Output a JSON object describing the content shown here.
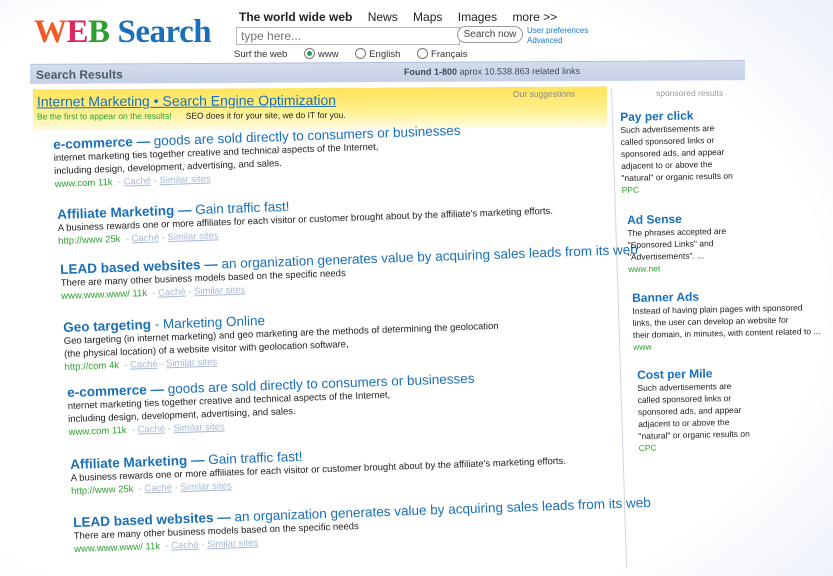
{
  "logo": {
    "w": "W",
    "e": "E",
    "b": "B",
    "search": "Search"
  },
  "nav": {
    "items": [
      "The world wide web",
      "News",
      "Maps",
      "Images",
      "more >>"
    ],
    "active": 0
  },
  "search": {
    "placeholder": "type here...",
    "button": "Search now"
  },
  "links": {
    "preferences": "User preferences",
    "advanced": "Advanced"
  },
  "surf": {
    "label": "Surf the web",
    "options": [
      "www",
      "English",
      "Français"
    ],
    "selected": 0
  },
  "results_bar": {
    "title": "Search Results",
    "found_bold": "Found 1-800",
    "found_rest": " aprox 10.538.863 related links"
  },
  "suggestion": {
    "label": "Our suggestions",
    "title": "Internet Marketing • Search Engine Optimization",
    "tagline": "Be the first to appear on the results!",
    "text": "SEO does it for your site, we do IT for you."
  },
  "results": [
    {
      "bold": "e-commerce —",
      "rest": " goods are sold directly to consumers or businesses",
      "desc": [
        "internet marketing ties together creative and technical aspects of the Internet,",
        "including design, development, advertising, and sales."
      ],
      "url": "www.com  11k",
      "cache": "Caché",
      "similar": "Similar sites"
    },
    {
      "bold": "Affiliate Marketing —",
      "rest": " Gain traffic fast!",
      "desc": [
        "A business rewards one or more affiliates for each visitor or customer brought about by the affiliate's marketing efforts."
      ],
      "url": "http://www  25k",
      "cache": "Caché",
      "similar": "Similar sites"
    },
    {
      "bold": "LEAD based websites —",
      "rest": " an organization generates value by acquiring sales leads from its web",
      "desc": [
        "There are many other business models based on the specific needs"
      ],
      "url": "www.www.www/  11k",
      "cache": "Caché",
      "similar": "Similar sites"
    },
    {
      "bold": "Geo targeting",
      "rest": " - Marketing Online",
      "desc": [
        "Geo targeting (in internet marketing) and geo marketing are the methods of determining the geolocation",
        "(the physical location) of a website visitor with geolocation software,"
      ],
      "url": "http://com 4k",
      "cache": "Caché",
      "similar": "Similar sites"
    },
    {
      "bold": "e-commerce —",
      "rest": " goods are sold directly to consumers or businesses",
      "desc": [
        "nternet marketing ties together creative and technical aspects of the Internet,",
        "including design, development, advertising, and sales."
      ],
      "url": "www.com  11k",
      "cache": "Caché",
      "similar": "Similar sites"
    },
    {
      "bold": "Affiliate Marketing —",
      "rest": " Gain traffic fast!",
      "desc": [
        "A business rewards one or more affiliates for each visitor or customer brought about by the affiliate's marketing efforts."
      ],
      "url": "http://www  25k",
      "cache": "Caché",
      "similar": "Similar sites"
    },
    {
      "bold": "LEAD based websites —",
      "rest": " an organization generates value by acquiring sales leads from its web",
      "desc": [
        "There are many other business models based on the specific needs"
      ],
      "url": "www.www.www/  11k",
      "cache": "Caché",
      "similar": "Similar sites"
    }
  ],
  "sponsored": {
    "label": "sponsored results",
    "ads": [
      {
        "title": "Pay per click",
        "desc": [
          "Such advertisements are",
          "called sponsored links or",
          "sponsored ads, and appear",
          "adjacent to or above the",
          "\"natural\" or organic results on"
        ],
        "url": "PPC"
      },
      {
        "title": "Ad Sense",
        "desc": [
          "The phrases accepted are",
          "\"Sponsored Links\" and",
          "\"Advertisements\". ..."
        ],
        "url": "www.net"
      },
      {
        "title": "Banner Ads",
        "desc": [
          "Instead of having plain pages with sponsored",
          "links, the user can develop an website for",
          "their domain, in minutes, with content related to ..."
        ],
        "url": "www"
      },
      {
        "title": "Cost per Mile",
        "desc": [
          "Such advertisements are",
          "called sponsored links or",
          "sponsored ads, and appear",
          "adjacent to or above the",
          "\"natural\" or organic results on"
        ],
        "url": "CPC"
      }
    ]
  }
}
